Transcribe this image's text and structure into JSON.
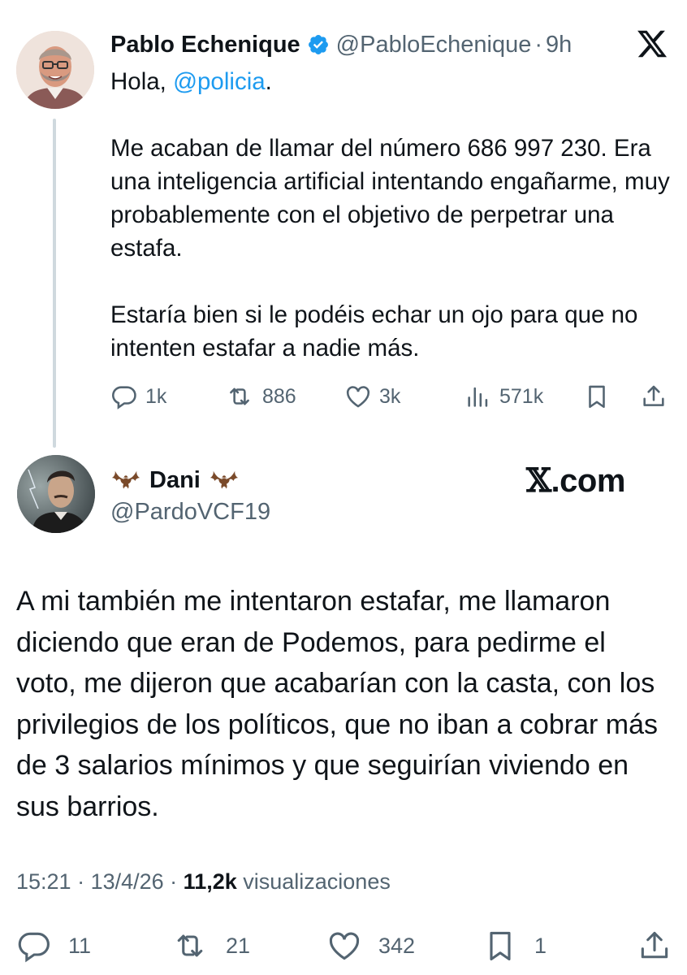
{
  "tweet1": {
    "author_name": "Pablo Echenique",
    "handle": "@PabloEchenique",
    "separator": "·",
    "time": "9h",
    "body_intro": "Hola, ",
    "mention": "@policia",
    "mention_suffix": ".",
    "paragraph1": "Me acaban de llamar del número 686 997 230. Era una inteligencia artificial intentando engañarme, muy probablemente con el objetivo de perpetrar una estafa.",
    "paragraph2": "Estaría bien si le podéis echar un ojo para que no intenten estafar a nadie más.",
    "actions": {
      "replies": "1k",
      "retweets": "886",
      "likes": "3k",
      "views": "571k"
    }
  },
  "tweet2": {
    "author_name": "Dani",
    "handle": "@PardoVCF19",
    "watermark_x": "𝕏",
    "watermark_text": ".com",
    "body": "A mi también me intentaron estafar, me llamaron diciendo que eran de Podemos, para pedirme el voto, me dijeron que acabarían con la casta, con los privilegios de los políticos, que no iban a cobrar más de 3 salarios mínimos y que seguirían viviendo en sus barrios.",
    "meta": {
      "time": "15:21",
      "sep1": " · ",
      "date": "13/4/26",
      "sep2": " · ",
      "views_count": "11,2k",
      "views_label": " visualizaciones"
    },
    "actions": {
      "replies": "11",
      "retweets": "21",
      "likes": "342",
      "bookmarks": "1"
    }
  },
  "colors": {
    "text": "#0f1419",
    "secondary": "#536471",
    "link": "#1d9bf0",
    "verified": "#1d9bf0",
    "thread_line": "#cfd9de"
  },
  "icons": [
    "verified-badge-icon",
    "x-logo-icon",
    "reply-icon",
    "retweet-icon",
    "like-icon",
    "views-icon",
    "bookmark-icon",
    "share-icon",
    "bat-icon"
  ]
}
